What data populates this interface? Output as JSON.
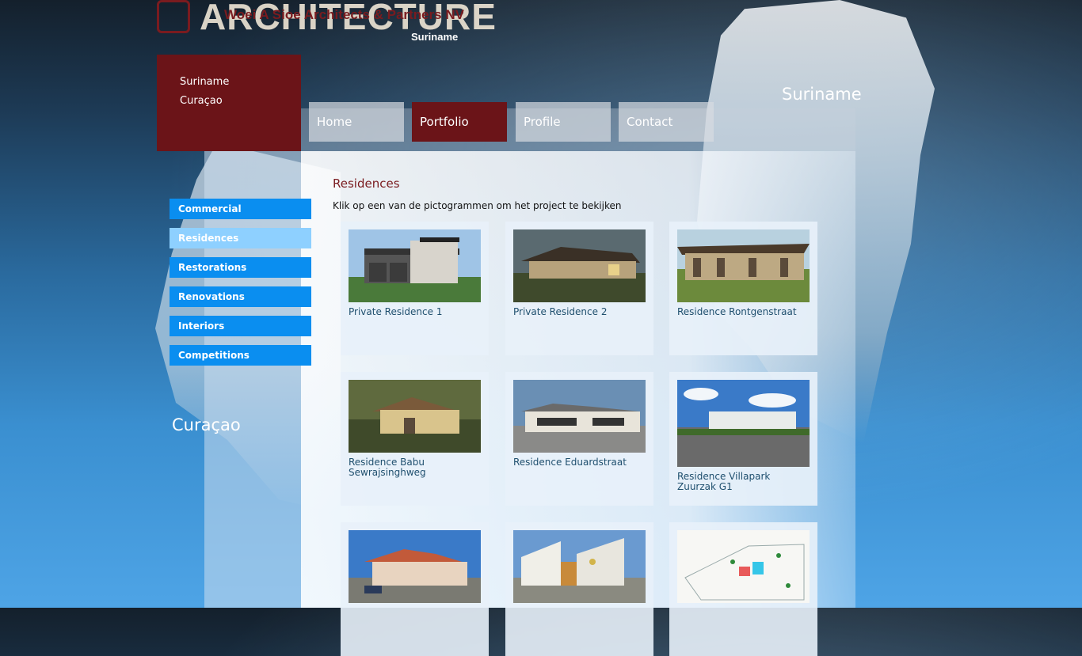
{
  "logo": {
    "word": "ARCHITECTURE",
    "firm": "Woei A Sioe Architects & Partners NV",
    "subtitle": "Suriname"
  },
  "regions": {
    "suriname": "Suriname",
    "curacao": "Curaçao"
  },
  "map_labels": {
    "suriname": "Suriname",
    "curacao": "Curaçao"
  },
  "nav": [
    {
      "label": "Home"
    },
    {
      "label": "Portfolio"
    },
    {
      "label": "Profile"
    },
    {
      "label": "Contact"
    }
  ],
  "sidebar": [
    {
      "label": "Commercial"
    },
    {
      "label": "Residences"
    },
    {
      "label": "Restorations"
    },
    {
      "label": "Renovations"
    },
    {
      "label": "Interiors"
    },
    {
      "label": "Competitions"
    }
  ],
  "page": {
    "title": "Residences",
    "description": "Klik op een van de pictogrammen om het project te bekijken"
  },
  "projects": [
    {
      "title": "Private Residence 1"
    },
    {
      "title": "Private Residence 2"
    },
    {
      "title": "Residence Rontgenstraat"
    },
    {
      "title": "Residence Babu Sewrajsinghweg"
    },
    {
      "title": "Residence Eduardstraat"
    },
    {
      "title": "Residence Villapark Zuurzak G1"
    },
    {
      "title": ""
    },
    {
      "title": ""
    },
    {
      "title": ""
    }
  ],
  "colors": {
    "brand": "#6b1418",
    "sidebar": "#0a8ef0",
    "sidebar_active": "#8ed0ff"
  }
}
